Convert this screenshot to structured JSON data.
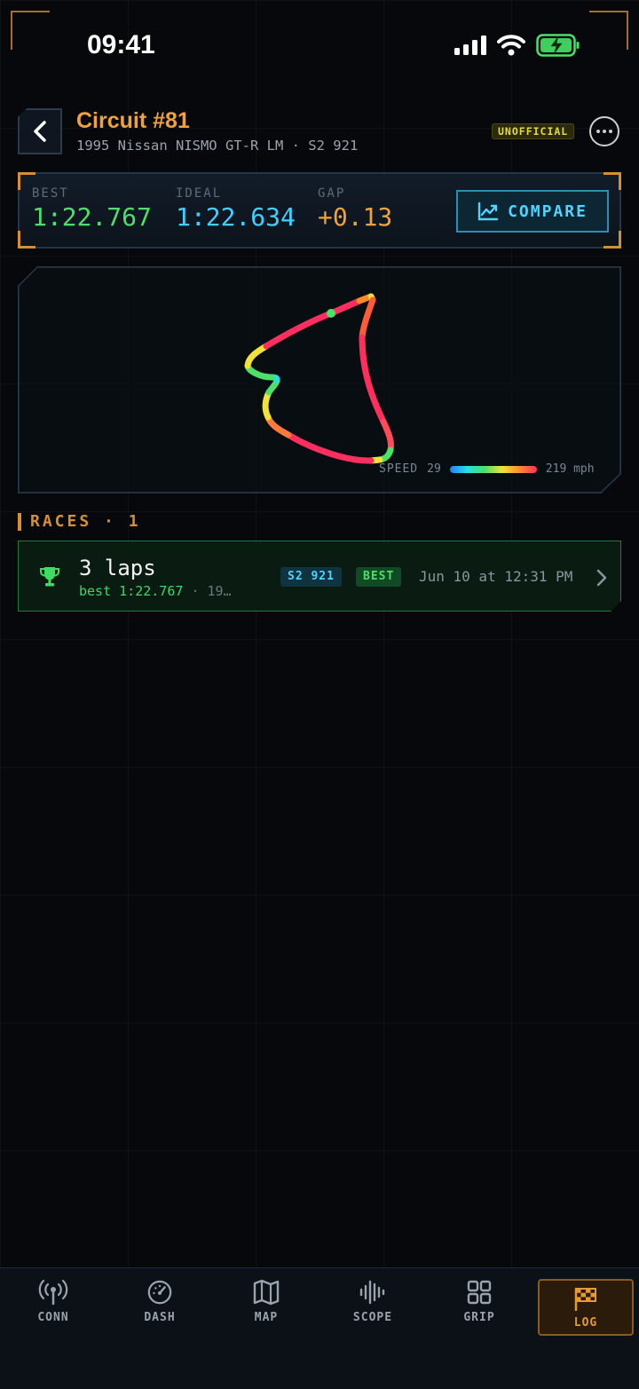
{
  "status": {
    "time": "09:41"
  },
  "header": {
    "title": "Circuit #81",
    "subtitle": "1995 Nissan NISMO GT-R LM · S2 921",
    "badge": "UNOFFICIAL"
  },
  "stats": {
    "best_label": "BEST",
    "best_value": "1:22.767",
    "ideal_label": "IDEAL",
    "ideal_value": "1:22.634",
    "gap_label": "GAP",
    "gap_value": "+0.13",
    "compare_label": "COMPARE"
  },
  "map": {
    "legend_label": "SPEED",
    "speed_min": "29",
    "speed_max": "219 mph"
  },
  "races": {
    "heading": "RACES · 1",
    "items": [
      {
        "title": "3 laps",
        "best_text": "best 1:22.767",
        "extra_text": " · 19…",
        "class_tag": "S2 921",
        "best_tag": "BEST",
        "date": "Jun 10 at 12:31 PM"
      }
    ]
  },
  "tabs": [
    {
      "label": "CONN",
      "icon": "antenna-icon"
    },
    {
      "label": "DASH",
      "icon": "speedometer-icon"
    },
    {
      "label": "MAP",
      "icon": "map-icon"
    },
    {
      "label": "SCOPE",
      "icon": "waveform-icon"
    },
    {
      "label": "GRIP",
      "icon": "grid-icon"
    },
    {
      "label": "LOG",
      "icon": "checkered-flag-icon",
      "active": true
    }
  ],
  "colors": {
    "accent": "#f0a23a",
    "best": "#4be067",
    "ideal": "#4fd3ff",
    "gap": "#f0a23a"
  }
}
